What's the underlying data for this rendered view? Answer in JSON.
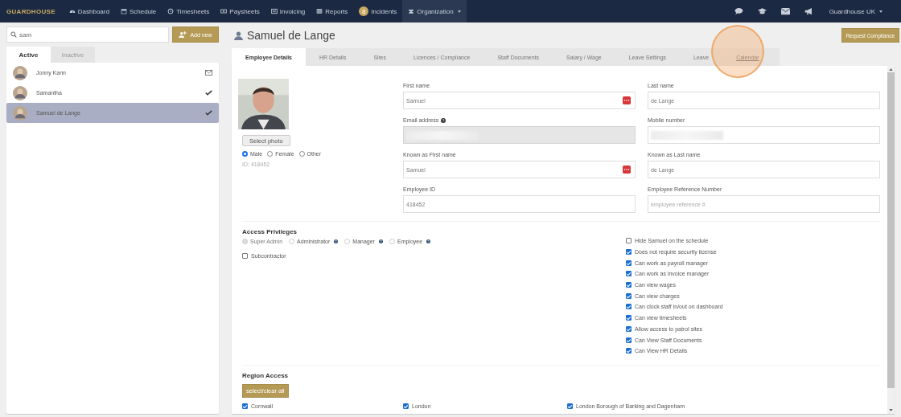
{
  "nav": {
    "brand": "GUARDHOUSE",
    "items": [
      {
        "label": "Dashboard",
        "selected": false
      },
      {
        "label": "Schedule",
        "selected": false
      },
      {
        "label": "Timesheets",
        "selected": false
      },
      {
        "label": "Paysheets",
        "selected": false
      },
      {
        "label": "Invoicing",
        "selected": false
      },
      {
        "label": "Reports",
        "selected": false
      },
      {
        "label": "Incidents",
        "badge": "8",
        "selected": false
      },
      {
        "label": "Organization",
        "dropdown": true,
        "selected": true
      }
    ],
    "account": "Guardhouse UK"
  },
  "search": {
    "value": "sam"
  },
  "add_button": "Add new",
  "list_tabs": [
    {
      "label": "Active",
      "selected": true
    },
    {
      "label": "Inactive",
      "selected": false
    }
  ],
  "people": [
    {
      "name": "Jonny Kann",
      "kind": "invited",
      "selected": false
    },
    {
      "name": "Samantha",
      "kind": "active",
      "selected": false
    },
    {
      "name": "Samuel de Lange",
      "kind": "active",
      "selected": true
    }
  ],
  "title": "Samuel de Lange",
  "compliance_button": "Request Compliance",
  "tabs": [
    {
      "label": "Employee Details",
      "selected": true,
      "highlighted": false
    },
    {
      "label": "HR Details",
      "selected": false,
      "highlighted": false
    },
    {
      "label": "Sites",
      "selected": false,
      "highlighted": false
    },
    {
      "label": "Licences / Compliance",
      "selected": false,
      "highlighted": false
    },
    {
      "label": "Staff Documents",
      "selected": false,
      "highlighted": false
    },
    {
      "label": "Salary / Wage",
      "selected": false,
      "highlighted": false
    },
    {
      "label": "Leave Settings",
      "selected": false,
      "highlighted": false
    },
    {
      "label": "Leave",
      "selected": false,
      "highlighted": false
    },
    {
      "label": "Calendar",
      "selected": false,
      "highlighted": true
    }
  ],
  "photo": {
    "kind": "picture",
    "button": "Select photo"
  },
  "gender": [
    {
      "label": "Male",
      "selected": true
    },
    {
      "label": "Female",
      "selected": false
    },
    {
      "label": "Other",
      "selected": false
    }
  ],
  "employee_id_label": "ID: 418452",
  "fields": [
    {
      "label": "First name",
      "value": "Samuel",
      "help": false,
      "redacted": false,
      "readonly": false,
      "action": true
    },
    {
      "label": "Last name",
      "value": "de Lange",
      "help": false,
      "redacted": false,
      "readonly": false,
      "action": false
    },
    {
      "label": "Email address",
      "help": true,
      "redacted": true,
      "readonly": true,
      "action": false
    },
    {
      "label": "Mobile number",
      "help": false,
      "redacted": true,
      "readonly": false,
      "action": false
    },
    {
      "label": "Known as First name",
      "value": "Samuel",
      "help": false,
      "redacted": false,
      "readonly": false,
      "action": true
    },
    {
      "label": "Known as Last name",
      "value": "de Lange",
      "help": false,
      "redacted": false,
      "readonly": false,
      "action": false
    },
    {
      "label": "Employee ID",
      "value": "418452",
      "help": false,
      "redacted": false,
      "readonly": false,
      "action": false
    },
    {
      "label": "Employee Reference Number",
      "placeholder": "employee reference #",
      "help": false,
      "redacted": false,
      "readonly": false,
      "action": false
    }
  ],
  "access": {
    "title": "Access Privileges",
    "roles": [
      {
        "label": "Super Admin",
        "selected": false,
        "disabled": true,
        "help": false
      },
      {
        "label": "Administrator",
        "selected": false,
        "disabled": false,
        "help": true
      },
      {
        "label": "Manager",
        "selected": false,
        "disabled": false,
        "help": true
      },
      {
        "label": "Employee",
        "selected": false,
        "disabled": false,
        "help": true
      }
    ],
    "subcontractor": {
      "label": "Subcontractor",
      "checked": false
    },
    "permissions": [
      {
        "label": "Hide Samuel on the schedule",
        "checked": false
      },
      {
        "label": "Does not require security license",
        "checked": true
      },
      {
        "label": "Can work as payroll manager",
        "checked": true
      },
      {
        "label": "Can work as invoice manager",
        "checked": true
      },
      {
        "label": "Can view wages",
        "checked": true
      },
      {
        "label": "Can view charges",
        "checked": true
      },
      {
        "label": "Can clock staff in/out on dashboard",
        "checked": true
      },
      {
        "label": "Can view timesheets",
        "checked": true
      },
      {
        "label": "Allow access to patrol sites",
        "checked": true
      },
      {
        "label": "Can View Staff Documents",
        "checked": true
      },
      {
        "label": "Can View HR Details",
        "checked": true
      }
    ]
  },
  "regions": {
    "title": "Region Access",
    "button": "select/clear all",
    "items": [
      {
        "label": "Cornwall",
        "checked": true
      },
      {
        "label": "London",
        "checked": true
      },
      {
        "label": "London Borough of Barking and Dagenham",
        "checked": true
      }
    ]
  }
}
